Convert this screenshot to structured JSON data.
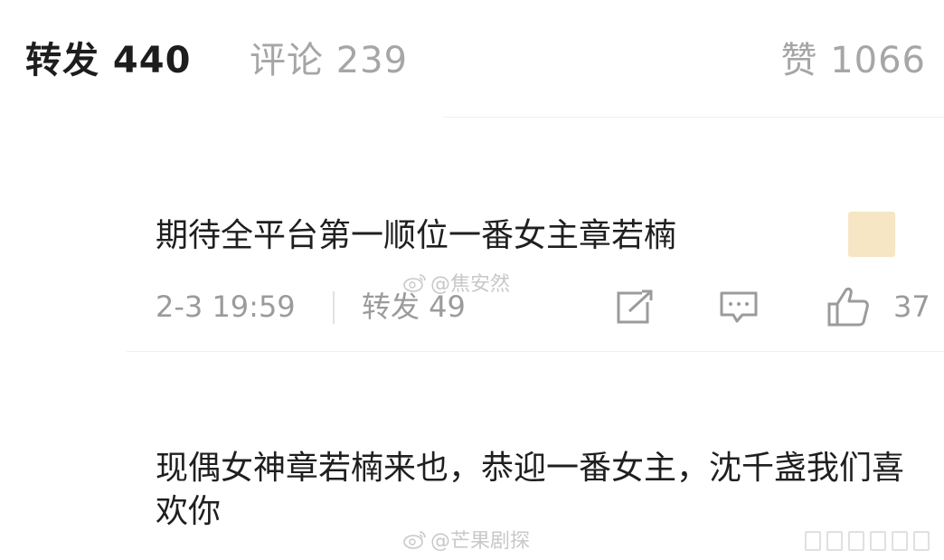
{
  "tabs": {
    "repost": "转发 440",
    "comment": "评论 239",
    "like": "赞 1066"
  },
  "comment1": {
    "text": "期待全平台第一顺位一番女主章若楠",
    "time": "2-3 19:59",
    "repost": "转发 49",
    "like_count": "37",
    "emoji_color": "#f6e6c4"
  },
  "watermark1": "@焦安然",
  "comment2": {
    "text": "现偶女神章若楠来也，恭迎一番女主，沈千盏我们喜欢你"
  },
  "watermark2": "@芒果剧探",
  "icons": [
    "weibo-logo-icon",
    "share-icon",
    "comment-icon",
    "thumbs-up-icon"
  ]
}
